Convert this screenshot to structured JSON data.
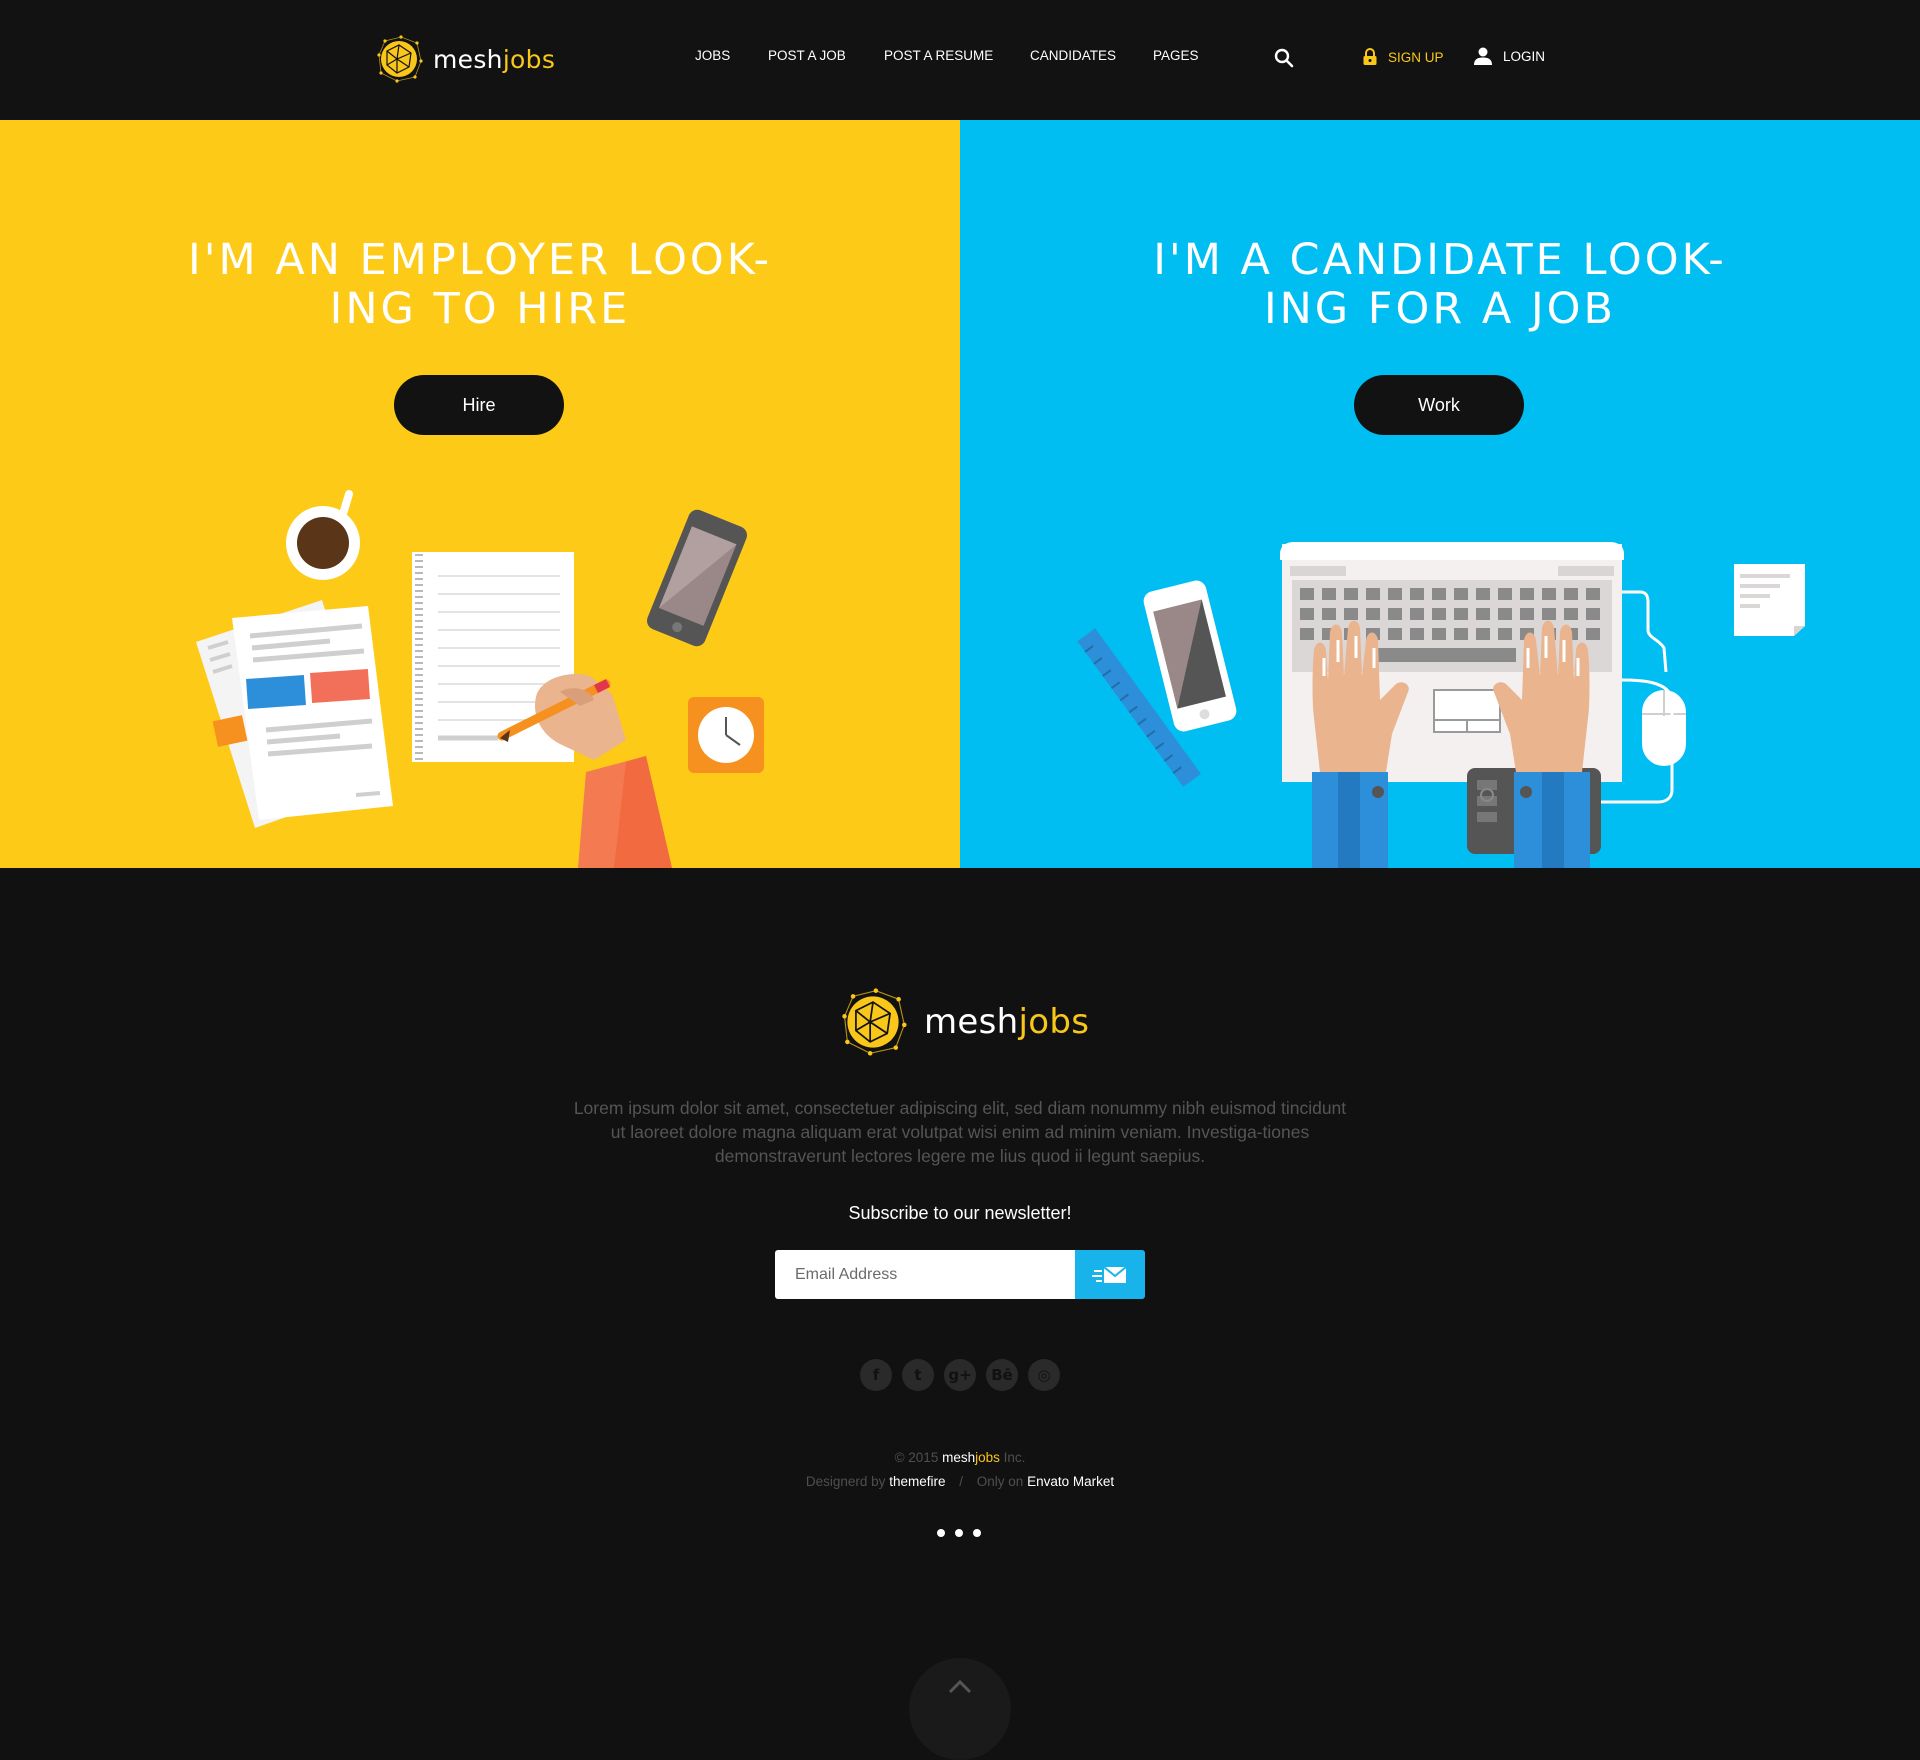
{
  "brand": {
    "prefix": "mesh",
    "suffix": "jobs"
  },
  "nav": {
    "items": [
      {
        "label": "JOBS"
      },
      {
        "label": "POST A JOB"
      },
      {
        "label": "POST A RESUME"
      },
      {
        "label": "CANDIDATES"
      },
      {
        "label": "PAGES"
      }
    ],
    "search_icon": "search-icon",
    "signup_label": "SIGN UP",
    "signup_icon": "lock-icon",
    "login_label": "LOGIN",
    "login_icon": "user-icon"
  },
  "hero": {
    "employer": {
      "heading_line1": "I'M AN EMPLOYER LOOK-",
      "heading_line2": "ING TO HIRE",
      "button_label": "Hire",
      "background": "#fdca17"
    },
    "candidate": {
      "heading_line1": "I'M A CANDIDATE LOOK-",
      "heading_line2": "ING FOR A JOB",
      "button_label": "Work",
      "background": "#00bef2"
    }
  },
  "footer": {
    "description": "Lorem ipsum dolor sit amet, consectetuer adipiscing elit, sed diam nonummy nibh euismod tincidunt ut laoreet dolore magna aliquam erat volutpat wisi enim ad minim veniam. Investiga-tiones demonstraverunt lectores legere me lius quod ii legunt saepius.",
    "newsletter_label": "Subscribe to our newsletter!",
    "email_placeholder": "Email Address",
    "send_icon": "send-mail-icon",
    "social": [
      {
        "icon": "facebook-icon",
        "glyph": "f"
      },
      {
        "icon": "twitter-icon",
        "glyph": "t"
      },
      {
        "icon": "google-plus-icon",
        "glyph": "g+"
      },
      {
        "icon": "behance-icon",
        "glyph": "Bē"
      },
      {
        "icon": "dribbble-icon",
        "glyph": "◎"
      }
    ],
    "copyright_year": "© 2015",
    "company_suffix": "Inc.",
    "designed_by_label": "Designerd by",
    "designer": "themefire",
    "separator": "/",
    "only_on_label": "Only on",
    "marketplace": "Envato Market",
    "back_to_top_icon": "chevron-up-icon"
  },
  "colors": {
    "accent": "#f9c61a",
    "employer_bg": "#fdca17",
    "candidate_bg": "#00bef2",
    "dark": "#121212",
    "send_button": "#18b3ea"
  }
}
